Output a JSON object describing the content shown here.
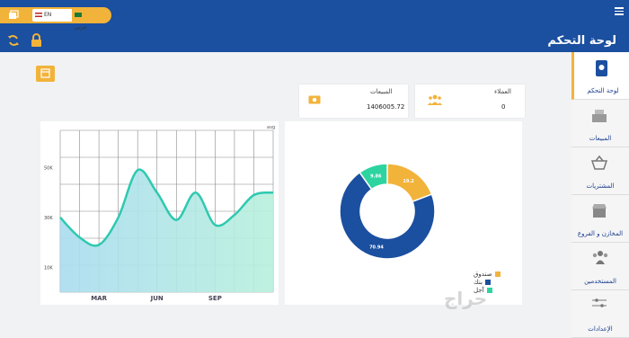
{
  "header": {
    "title": "لوحة التحكم",
    "lang_en": "EN",
    "lang_ar": "عربي"
  },
  "sidebar": {
    "items": [
      {
        "label": "لوحة التحكم",
        "icon": "dashboard-icon",
        "active": true
      },
      {
        "label": "المبيعات",
        "icon": "cash-register-icon"
      },
      {
        "label": "المشتريات",
        "icon": "basket-icon"
      },
      {
        "label": "المخازن و الفروع",
        "icon": "store-icon"
      },
      {
        "label": "المستخدمين",
        "icon": "users-icon"
      },
      {
        "label": "الإعدادات",
        "icon": "sliders-icon"
      }
    ]
  },
  "cards": {
    "customers": {
      "title": "العملاء",
      "value": "0",
      "icon": "users-icon"
    },
    "sales": {
      "title": "المبيعات",
      "value": "1406005.72",
      "icon": "money-icon"
    }
  },
  "colors": {
    "header": "#1b4f9f",
    "accent": "#f2b33a",
    "teal": "#2ec9b0",
    "navy": "#1b4f9f",
    "green": "#2dd4a0"
  },
  "chart_data": [
    {
      "type": "area",
      "x_tick_labels": [
        "MAR",
        "JUN",
        "SEP"
      ],
      "y_tick_labels": [
        "10K",
        "30K",
        "50K"
      ],
      "corner_label": "avg",
      "x": [
        0,
        1,
        2,
        3,
        4,
        5,
        6,
        7,
        8,
        9,
        10,
        11
      ],
      "values": [
        30,
        22,
        19,
        30,
        49,
        40,
        29,
        40,
        27,
        31,
        39,
        40
      ],
      "ylim": [
        0,
        65
      ],
      "grid": true
    },
    {
      "type": "pie",
      "donut": true,
      "slices": [
        {
          "label": "صندوق",
          "value": 19.2,
          "text": "19.2",
          "color": "#f2b33a"
        },
        {
          "label": "بنك",
          "value": 70.94,
          "text": "70.94",
          "color": "#1b4f9f"
        },
        {
          "label": "آجل",
          "value": 9.86,
          "text": "9.86",
          "color": "#2dd4a0"
        }
      ],
      "legend_position": "bottom-right"
    }
  ]
}
